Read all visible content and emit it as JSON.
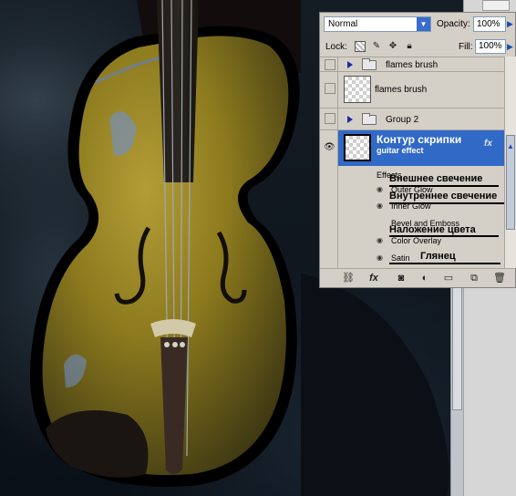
{
  "layers_panel": {
    "blend_mode": "Normal",
    "opacity_label": "Opacity:",
    "opacity_value": "100%",
    "lock_label": "Lock:",
    "fill_label": "Fill:",
    "fill_value": "100%",
    "layers": [
      {
        "name": "flames brush",
        "type": "group"
      },
      {
        "name": "flames brush",
        "type": "layer"
      },
      {
        "name": "Group 2",
        "type": "group"
      },
      {
        "name": "Контур скрипки",
        "subtitle": "guitar effect",
        "type": "layer",
        "selected": true,
        "fx": "fx"
      }
    ],
    "effects_label": "Effects",
    "effects": [
      {
        "name": "Outer Glow",
        "translation": "Внешнее свечение"
      },
      {
        "name": "Inner Glow",
        "translation": "Внутреннее свечение"
      },
      {
        "name": "Bevel and Emboss",
        "translation": ""
      },
      {
        "name": "Color Overlay",
        "translation": "Наложение цвета"
      },
      {
        "name": "Satin",
        "translation": "Глянец"
      }
    ],
    "bottom_icons": [
      "link-icon",
      "fx-icon",
      "mask-icon",
      "adjustment-icon",
      "folder-icon",
      "new-layer-icon",
      "trash-icon"
    ],
    "icons": {
      "blend_dropdown": "chevron-down-icon",
      "opacity_stepper": "chevron-right-icon",
      "fill_stepper": "chevron-right-icon",
      "lock_transparency": "checkerboard-icon",
      "lock_pixels": "brush-icon",
      "lock_position": "move-icon",
      "lock_all": "padlock-icon",
      "visibility": "eye-icon",
      "expand": "triangle-right-icon",
      "group": "folder-icon"
    }
  },
  "colors": {
    "selection": "#3169c6",
    "panel_bg": "#d4d0c8",
    "violin_body": "#8c7a1e"
  }
}
